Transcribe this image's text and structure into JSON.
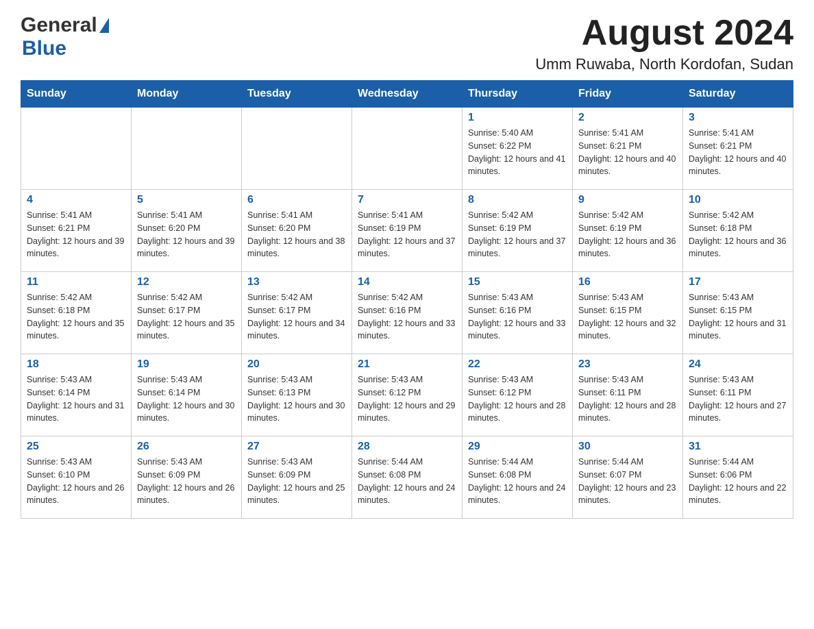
{
  "header": {
    "logo_general": "General",
    "logo_blue": "Blue",
    "month_title": "August 2024",
    "location": "Umm Ruwaba, North Kordofan, Sudan"
  },
  "weekdays": [
    "Sunday",
    "Monday",
    "Tuesday",
    "Wednesday",
    "Thursday",
    "Friday",
    "Saturday"
  ],
  "weeks": [
    {
      "days": [
        {
          "number": "",
          "info": ""
        },
        {
          "number": "",
          "info": ""
        },
        {
          "number": "",
          "info": ""
        },
        {
          "number": "",
          "info": ""
        },
        {
          "number": "1",
          "info": "Sunrise: 5:40 AM\nSunset: 6:22 PM\nDaylight: 12 hours and 41 minutes."
        },
        {
          "number": "2",
          "info": "Sunrise: 5:41 AM\nSunset: 6:21 PM\nDaylight: 12 hours and 40 minutes."
        },
        {
          "number": "3",
          "info": "Sunrise: 5:41 AM\nSunset: 6:21 PM\nDaylight: 12 hours and 40 minutes."
        }
      ]
    },
    {
      "days": [
        {
          "number": "4",
          "info": "Sunrise: 5:41 AM\nSunset: 6:21 PM\nDaylight: 12 hours and 39 minutes."
        },
        {
          "number": "5",
          "info": "Sunrise: 5:41 AM\nSunset: 6:20 PM\nDaylight: 12 hours and 39 minutes."
        },
        {
          "number": "6",
          "info": "Sunrise: 5:41 AM\nSunset: 6:20 PM\nDaylight: 12 hours and 38 minutes."
        },
        {
          "number": "7",
          "info": "Sunrise: 5:41 AM\nSunset: 6:19 PM\nDaylight: 12 hours and 37 minutes."
        },
        {
          "number": "8",
          "info": "Sunrise: 5:42 AM\nSunset: 6:19 PM\nDaylight: 12 hours and 37 minutes."
        },
        {
          "number": "9",
          "info": "Sunrise: 5:42 AM\nSunset: 6:19 PM\nDaylight: 12 hours and 36 minutes."
        },
        {
          "number": "10",
          "info": "Sunrise: 5:42 AM\nSunset: 6:18 PM\nDaylight: 12 hours and 36 minutes."
        }
      ]
    },
    {
      "days": [
        {
          "number": "11",
          "info": "Sunrise: 5:42 AM\nSunset: 6:18 PM\nDaylight: 12 hours and 35 minutes."
        },
        {
          "number": "12",
          "info": "Sunrise: 5:42 AM\nSunset: 6:17 PM\nDaylight: 12 hours and 35 minutes."
        },
        {
          "number": "13",
          "info": "Sunrise: 5:42 AM\nSunset: 6:17 PM\nDaylight: 12 hours and 34 minutes."
        },
        {
          "number": "14",
          "info": "Sunrise: 5:42 AM\nSunset: 6:16 PM\nDaylight: 12 hours and 33 minutes."
        },
        {
          "number": "15",
          "info": "Sunrise: 5:43 AM\nSunset: 6:16 PM\nDaylight: 12 hours and 33 minutes."
        },
        {
          "number": "16",
          "info": "Sunrise: 5:43 AM\nSunset: 6:15 PM\nDaylight: 12 hours and 32 minutes."
        },
        {
          "number": "17",
          "info": "Sunrise: 5:43 AM\nSunset: 6:15 PM\nDaylight: 12 hours and 31 minutes."
        }
      ]
    },
    {
      "days": [
        {
          "number": "18",
          "info": "Sunrise: 5:43 AM\nSunset: 6:14 PM\nDaylight: 12 hours and 31 minutes."
        },
        {
          "number": "19",
          "info": "Sunrise: 5:43 AM\nSunset: 6:14 PM\nDaylight: 12 hours and 30 minutes."
        },
        {
          "number": "20",
          "info": "Sunrise: 5:43 AM\nSunset: 6:13 PM\nDaylight: 12 hours and 30 minutes."
        },
        {
          "number": "21",
          "info": "Sunrise: 5:43 AM\nSunset: 6:12 PM\nDaylight: 12 hours and 29 minutes."
        },
        {
          "number": "22",
          "info": "Sunrise: 5:43 AM\nSunset: 6:12 PM\nDaylight: 12 hours and 28 minutes."
        },
        {
          "number": "23",
          "info": "Sunrise: 5:43 AM\nSunset: 6:11 PM\nDaylight: 12 hours and 28 minutes."
        },
        {
          "number": "24",
          "info": "Sunrise: 5:43 AM\nSunset: 6:11 PM\nDaylight: 12 hours and 27 minutes."
        }
      ]
    },
    {
      "days": [
        {
          "number": "25",
          "info": "Sunrise: 5:43 AM\nSunset: 6:10 PM\nDaylight: 12 hours and 26 minutes."
        },
        {
          "number": "26",
          "info": "Sunrise: 5:43 AM\nSunset: 6:09 PM\nDaylight: 12 hours and 26 minutes."
        },
        {
          "number": "27",
          "info": "Sunrise: 5:43 AM\nSunset: 6:09 PM\nDaylight: 12 hours and 25 minutes."
        },
        {
          "number": "28",
          "info": "Sunrise: 5:44 AM\nSunset: 6:08 PM\nDaylight: 12 hours and 24 minutes."
        },
        {
          "number": "29",
          "info": "Sunrise: 5:44 AM\nSunset: 6:08 PM\nDaylight: 12 hours and 24 minutes."
        },
        {
          "number": "30",
          "info": "Sunrise: 5:44 AM\nSunset: 6:07 PM\nDaylight: 12 hours and 23 minutes."
        },
        {
          "number": "31",
          "info": "Sunrise: 5:44 AM\nSunset: 6:06 PM\nDaylight: 12 hours and 22 minutes."
        }
      ]
    }
  ]
}
